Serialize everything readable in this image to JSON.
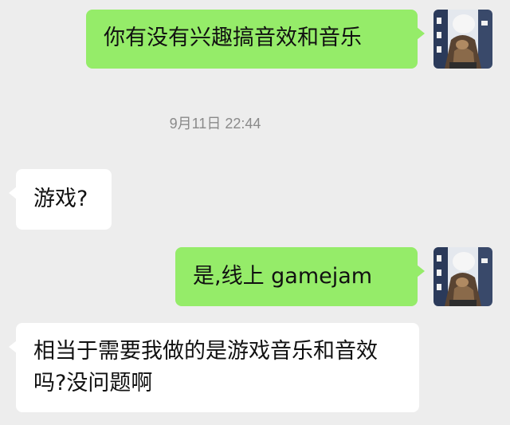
{
  "colors": {
    "background": "#ededed",
    "outgoing_bubble": "#95ec69",
    "incoming_bubble": "#ffffff",
    "timestamp_text": "#8a8a8a",
    "message_text": "#111111"
  },
  "chat": {
    "messages": [
      {
        "direction": "outgoing",
        "text": "你有没有兴趣搞音效和音乐"
      },
      {
        "direction": "incoming",
        "text": "游戏?"
      },
      {
        "direction": "outgoing",
        "text": "是,线上 gamejam"
      },
      {
        "direction": "incoming",
        "text": "相当于需要我做的是游戏音乐和音效吗?没问题啊"
      }
    ],
    "timestamp": "9月11日 22:44"
  },
  "avatar": {
    "icon": "user-avatar-photo"
  }
}
